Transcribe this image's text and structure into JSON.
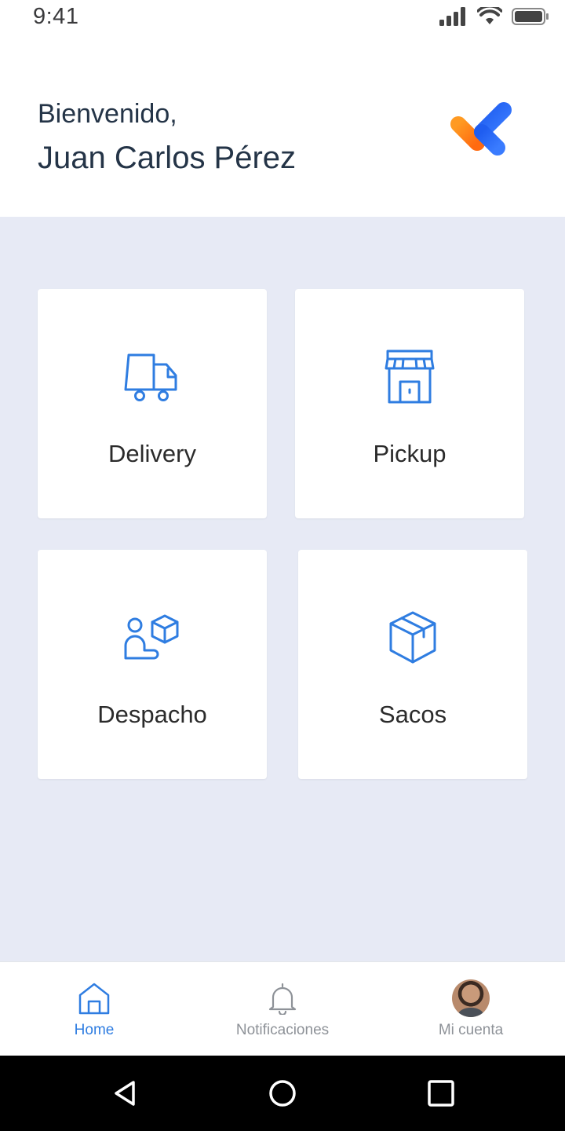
{
  "status_bar": {
    "time": "9:41",
    "icons": [
      "signal-icon",
      "wifi-icon",
      "battery-icon"
    ]
  },
  "header": {
    "greeting": "Bienvenido,",
    "user_name": "Juan Carlos Pérez",
    "logo": "brand-logo"
  },
  "tiles": [
    {
      "label": "Delivery",
      "icon": "truck-icon"
    },
    {
      "label": "Pickup",
      "icon": "store-icon"
    },
    {
      "label": "Despacho",
      "icon": "hand-package-icon"
    },
    {
      "label": "Sacos",
      "icon": "box-icon"
    }
  ],
  "bottom_nav": {
    "items": [
      {
        "label": "Home",
        "icon": "home-icon",
        "active": true
      },
      {
        "label": "Notificaciones",
        "icon": "bell-icon",
        "active": false
      },
      {
        "label": "Mi cuenta",
        "icon": "avatar",
        "active": false
      }
    ]
  },
  "android_nav": [
    "back-button",
    "home-button",
    "recents-button"
  ],
  "colors": {
    "accent": "#2f7de1",
    "background": "#e7eaf5",
    "logo_orange": "#ff8a1c",
    "logo_blue": "#2f6bf0",
    "nav_inactive": "#8e9298"
  }
}
